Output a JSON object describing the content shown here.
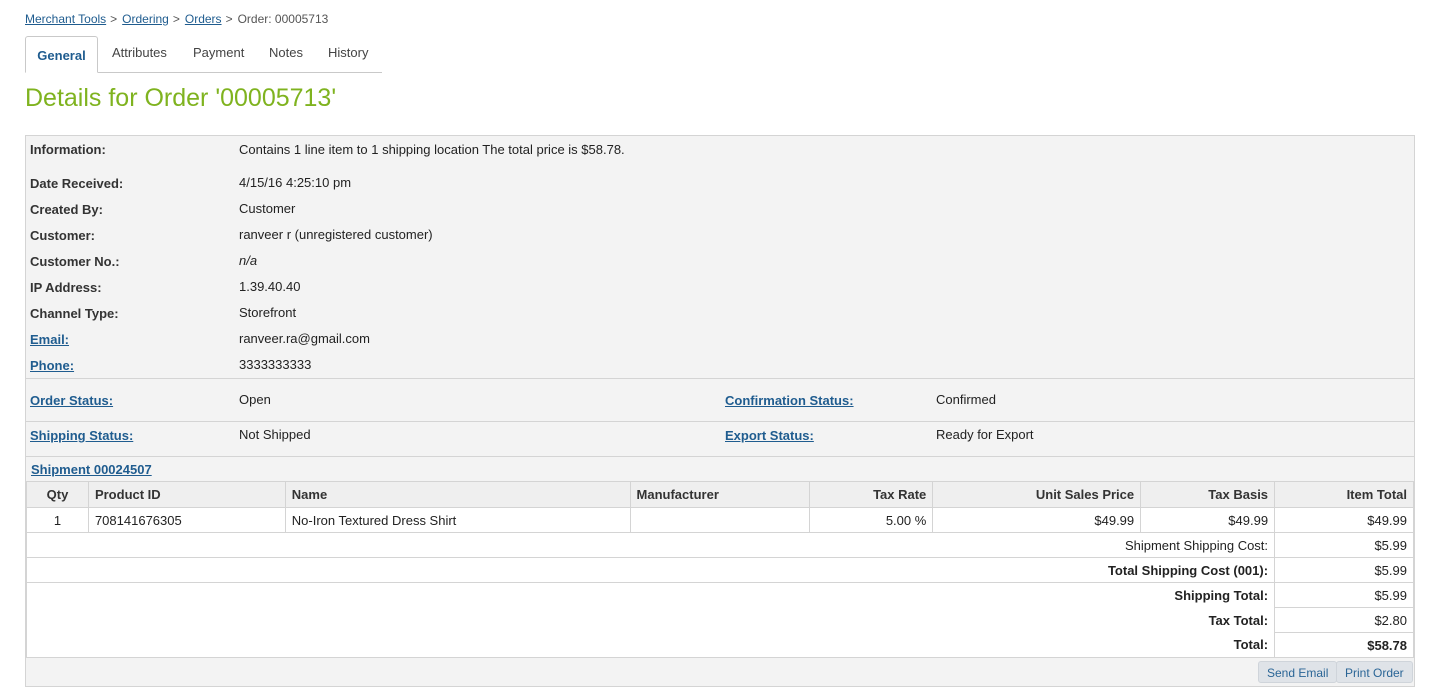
{
  "breadcrumb": {
    "items": [
      "Merchant Tools",
      "Ordering",
      "Orders"
    ],
    "separator": ">",
    "current": "Order: 00005713"
  },
  "tabs": [
    "General",
    "Attributes",
    "Payment",
    "Notes",
    "History"
  ],
  "active_tab": "General",
  "page_title": "Details for Order '00005713'",
  "details": {
    "information": {
      "label": "Information:",
      "value": "Contains 1 line item to 1 shipping location The total price is $58.78."
    },
    "date_received": {
      "label": "Date Received:",
      "value": "4/15/16 4:25:10 pm"
    },
    "created_by": {
      "label": "Created By:",
      "value": "Customer"
    },
    "customer": {
      "label": "Customer:",
      "value": "ranveer r (unregistered customer)"
    },
    "customer_no": {
      "label": "Customer No.:",
      "value": "n/a"
    },
    "ip_address": {
      "label": "IP Address:",
      "value": "1.39.40.40"
    },
    "channel_type": {
      "label": "Channel Type:",
      "value": "Storefront"
    },
    "email": {
      "label": "Email:",
      "value": "ranveer.ra@gmail.com"
    },
    "phone": {
      "label": "Phone:",
      "value": "3333333333"
    }
  },
  "status": {
    "order_status": {
      "label": "Order Status:",
      "value": "Open"
    },
    "confirmation_status": {
      "label": "Confirmation Status:",
      "value": "Confirmed"
    },
    "shipping_status": {
      "label": "Shipping Status:",
      "value": "Not Shipped"
    },
    "export_status": {
      "label": "Export Status:",
      "value": "Ready for Export"
    }
  },
  "shipment": {
    "link": "Shipment 00024507",
    "columns": [
      "Qty",
      "Product ID",
      "Name",
      "Manufacturer",
      "Tax Rate",
      "Unit Sales Price",
      "Tax Basis",
      "Item Total"
    ],
    "rows": [
      [
        "1",
        "708141676305",
        "No-Iron Textured Dress Shirt",
        "",
        "5.00 %",
        "$49.99",
        "$49.99",
        "$49.99"
      ]
    ],
    "totals": {
      "shipment_shipping_cost": {
        "label": "Shipment Shipping Cost:",
        "value": "$5.99"
      },
      "total_shipping_cost": {
        "label": "Total Shipping Cost (001):",
        "value": "$5.99"
      },
      "shipping_total": {
        "label": "Shipping Total:",
        "value": "$5.99"
      },
      "tax_total": {
        "label": "Tax Total:",
        "value": "$2.80"
      },
      "total": {
        "label": "Total:",
        "value": "$58.78"
      }
    }
  },
  "buttons": {
    "send_email": "Send Email",
    "print_order": "Print Order"
  },
  "colors": {
    "title": "#7fb31f",
    "link": "#1f5c8f",
    "panel": "#f3f3f3",
    "border": "#d4d4d4"
  }
}
